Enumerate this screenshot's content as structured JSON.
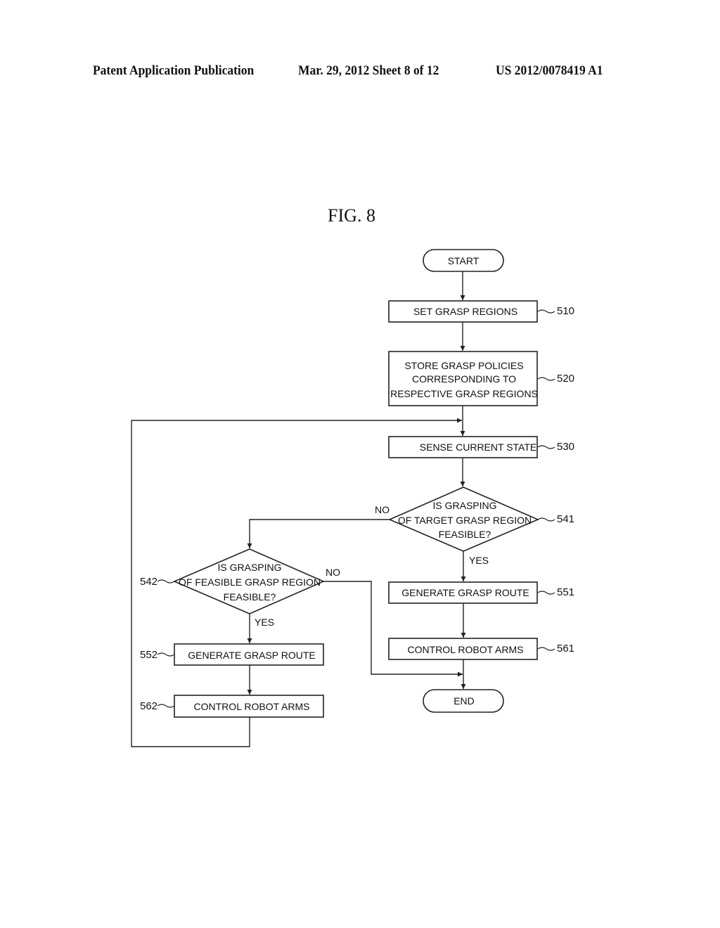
{
  "header": {
    "publication": "Patent Application Publication",
    "date_sheet": "Mar. 29, 2012  Sheet 8 of 12",
    "number": "US 2012/0078419 A1"
  },
  "figure": {
    "title": "FIG. 8"
  },
  "flowchart": {
    "start": "START",
    "end": "END",
    "steps": {
      "s510": {
        "ref": "510",
        "lines": [
          "SET GRASP REGIONS"
        ]
      },
      "s520": {
        "ref": "520",
        "lines": [
          "STORE GRASP POLICIES",
          "CORRESPONDING TO",
          "RESPECTIVE GRASP REGIONS"
        ]
      },
      "s530": {
        "ref": "530",
        "lines": [
          "SENSE CURRENT STATE"
        ]
      },
      "s541": {
        "ref": "541",
        "lines": [
          "IS GRASPING",
          "OF TARGET GRASP REGION",
          "FEASIBLE?"
        ]
      },
      "s542": {
        "ref": "542",
        "lines": [
          "IS GRASPING",
          "OF FEASIBLE GRASP REGION",
          "FEASIBLE?"
        ]
      },
      "s551": {
        "ref": "551",
        "lines": [
          "GENERATE GRASP ROUTE"
        ]
      },
      "s561": {
        "ref": "561",
        "lines": [
          "CONTROL ROBOT ARMS"
        ]
      },
      "s552": {
        "ref": "552",
        "lines": [
          "GENERATE GRASP ROUTE"
        ]
      },
      "s562": {
        "ref": "562",
        "lines": [
          "CONTROL ROBOT ARMS"
        ]
      }
    },
    "branch_labels": {
      "s541_no": "NO",
      "s541_yes": "YES",
      "s542_no": "NO",
      "s542_yes": "YES"
    }
  }
}
